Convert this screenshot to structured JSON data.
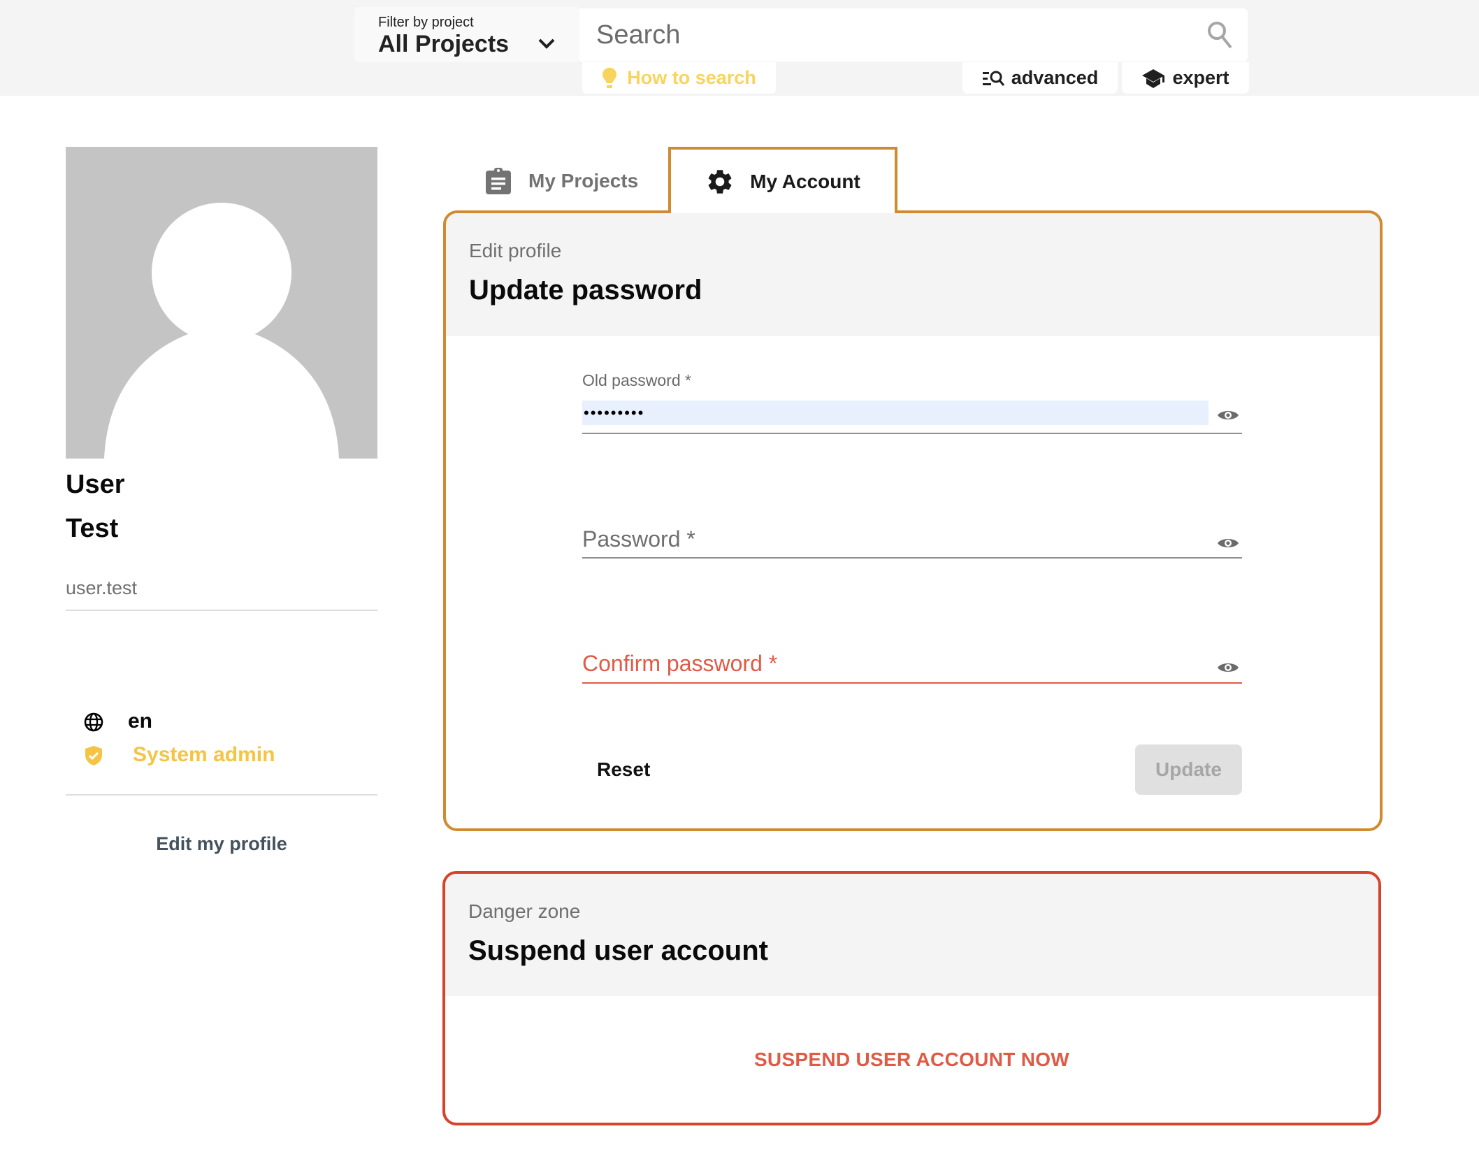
{
  "header": {
    "filter": {
      "label": "Filter by project",
      "selected": "All Projects"
    },
    "search": {
      "placeholder": "Search",
      "value": ""
    },
    "how_to_search": "How to search",
    "advanced_label": "advanced",
    "expert_label": "expert"
  },
  "profile": {
    "first_name": "User",
    "last_name": "Test",
    "username": "user.test",
    "language": "en",
    "role": "System admin",
    "edit_profile_link": "Edit my profile"
  },
  "tabs": [
    {
      "label": "My Projects",
      "icon": "clipboard-icon",
      "active": false
    },
    {
      "label": "My Account",
      "icon": "gear-icon",
      "active": true
    }
  ],
  "password_card": {
    "kicker": "Edit profile",
    "title": "Update password",
    "fields": {
      "old_password": {
        "label": "Old password *",
        "value": "•••••••••"
      },
      "password": {
        "label": "Password *",
        "value": ""
      },
      "confirm_password": {
        "label": "Confirm password *",
        "value": "",
        "error": true
      }
    },
    "reset_label": "Reset",
    "update_label": "Update",
    "update_disabled": true
  },
  "danger_card": {
    "kicker": "Danger zone",
    "title": "Suspend user account",
    "action_label": "SUSPEND USER ACCOUNT NOW"
  },
  "colors": {
    "accent_orange": "#d08a30",
    "danger_red": "#d8412a",
    "error_text": "#e05a45",
    "admin_yellow": "#f6c444",
    "howto_yellow": "#f9d45c"
  }
}
